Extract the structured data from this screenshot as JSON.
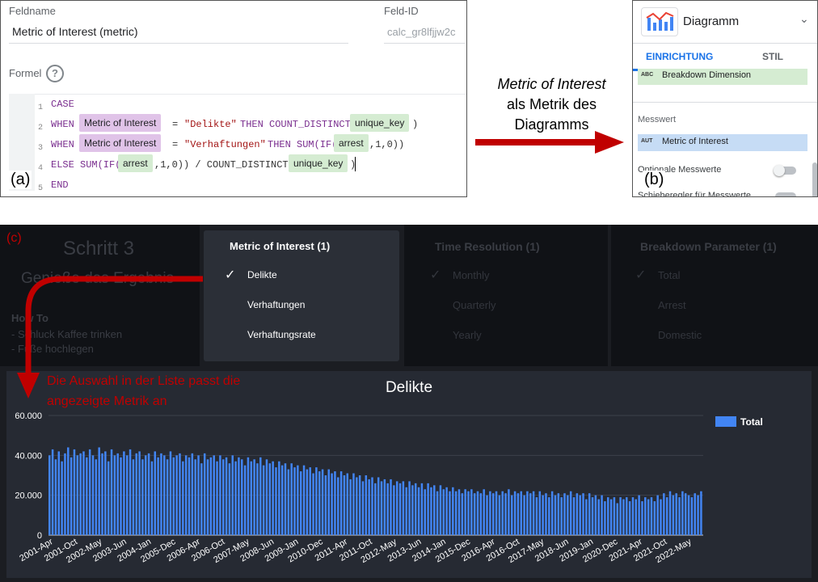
{
  "panel_a": {
    "tag": "(a)",
    "field_name_label": "Feldname",
    "field_name_value": "Metric of Interest (metric)",
    "field_id_label": "Feld-ID",
    "field_id_value": "calc_gr8lfjjw2c",
    "formula_label": "Formel",
    "help_icon": "?",
    "lines": [
      {
        "n": "1"
      },
      {
        "n": "2"
      },
      {
        "n": "3"
      },
      {
        "n": "4"
      },
      {
        "n": "5"
      }
    ],
    "code": {
      "case": "CASE",
      "when": "WHEN",
      "moi": "Metric of Interest",
      "eq_delikte": "= \"Delikte\" THEN COUNT_DISTINCT(",
      "eq_delikte_eq": "=",
      "str_delikte": "\"Delikte\"",
      "then_count": "THEN COUNT_DISTINCT(",
      "unique_key": "unique_key",
      "close": ")",
      "str_verh": "\"Verhaftungen\"",
      "then_sum": "THEN SUM(IF(",
      "arrest": "arrest",
      "one_zero_close": ",1,0))",
      "else_sum": "ELSE SUM(IF(",
      "div_count": ",1,0)) / COUNT_DISTINCT(",
      "end": "END"
    }
  },
  "arrow_text": {
    "line1": "Metric of Interest",
    "line2": "als Metrik des",
    "line3": "Diagramms"
  },
  "panel_b": {
    "tag": "(b)",
    "chart_type": "Diagramm",
    "tab_setup": "EINRICHTUNG",
    "tab_style": "STIL",
    "breakdown_badge": "ABC",
    "breakdown_label": "Breakdown Dimension",
    "metric_section": "Messwert",
    "metric_badge": "AUT",
    "metric_label": "Metric of Interest",
    "optional_metrics": "Optionale Messwerte",
    "metric_slider": "Schieberegler für Messwerte"
  },
  "panel_c": {
    "tag": "(c)",
    "step_title": "Schritt 3",
    "step_sub": "Genieße das Ergebnis",
    "howto_title": "How To",
    "howto_1": "- Schluck Kaffee trinken",
    "howto_2": "- Füße hochlegen",
    "dropdown_title": "Metric of Interest (1)",
    "dropdown_items": [
      "Delikte",
      "Verhaftungen",
      "Verhaftungsrate"
    ],
    "time_title": "Time Resolution (1)",
    "time_items": [
      "Monthly",
      "Quarterly",
      "Yearly"
    ],
    "breakdown_title": "Breakdown Parameter (1)",
    "breakdown_items": [
      "Total",
      "Arrest",
      "Domestic"
    ],
    "annotation_1": "Die Auswahl in der Liste passt die",
    "annotation_2": "angezeigte Metrik an"
  },
  "chart_data": {
    "type": "bar",
    "title": "Delikte",
    "xlabel": "",
    "ylabel": "",
    "ylim": [
      0,
      60000
    ],
    "y_ticks": [
      "0",
      "20.000",
      "40.000",
      "60.000"
    ],
    "x_tick_labels": [
      "2001-Apr",
      "2001-Oct",
      "2002-May",
      "2003-Jun",
      "2004-Jan",
      "2005-Dec",
      "2006-Apr",
      "2006-Oct",
      "2007-May",
      "2008-Jun",
      "2009-Jan",
      "2010-Dec",
      "2011-Apr",
      "2011-Oct",
      "2012-May",
      "2013-Jun",
      "2014-Jan",
      "2015-Dec",
      "2016-Apr",
      "2016-Oct",
      "2017-May",
      "2018-Jun",
      "2019-Jan",
      "2020-Dec",
      "2021-Apr",
      "2021-Oct",
      "2022-May"
    ],
    "series": [
      {
        "name": "Total",
        "color": "#4285f4",
        "values": [
          40000,
          43000,
          38000,
          42000,
          37000,
          41000,
          44000,
          39000,
          43000,
          40000,
          41000,
          42000,
          39000,
          43000,
          40000,
          38000,
          44000,
          41000,
          42000,
          37000,
          43000,
          40000,
          41000,
          39000,
          42000,
          40000,
          43000,
          38000,
          41000,
          42000,
          38000,
          40000,
          41000,
          37000,
          42000,
          39000,
          41000,
          40000,
          38000,
          42000,
          39000,
          40000,
          41000,
          37000,
          40000,
          39000,
          41000,
          38000,
          40000,
          36000,
          41000,
          38000,
          39000,
          40000,
          37000,
          40000,
          38000,
          39000,
          36000,
          40000,
          37000,
          39000,
          38000,
          35000,
          39000,
          37000,
          38000,
          36000,
          39000,
          35000,
          38000,
          36000,
          37000,
          34000,
          37000,
          35000,
          36000,
          33000,
          36000,
          34000,
          35000,
          32000,
          35000,
          33000,
          34000,
          31000,
          34000,
          32000,
          33000,
          30000,
          33000,
          31000,
          32000,
          29000,
          32000,
          30000,
          31000,
          28000,
          31000,
          29000,
          30000,
          27000,
          30000,
          28000,
          29000,
          26000,
          29000,
          27000,
          28000,
          26000,
          28000,
          25000,
          27000,
          26000,
          27000,
          24000,
          27000,
          25000,
          26000,
          24000,
          26000,
          23000,
          26000,
          24000,
          25000,
          22000,
          25000,
          23000,
          24000,
          22000,
          24000,
          22000,
          23000,
          21000,
          23000,
          22000,
          23000,
          21000,
          22000,
          21000,
          23000,
          20000,
          22000,
          21000,
          22000,
          20000,
          22000,
          21000,
          23000,
          20000,
          22000,
          21000,
          22000,
          20000,
          22000,
          21000,
          22000,
          19000,
          22000,
          20000,
          21000,
          19000,
          22000,
          20000,
          21000,
          19000,
          21000,
          20000,
          22000,
          19000,
          21000,
          20000,
          21000,
          18000,
          21000,
          19000,
          20000,
          18000,
          20000,
          17000,
          19000,
          18000,
          19000,
          16000,
          19000,
          18000,
          19000,
          17000,
          19000,
          18000,
          20000,
          17000,
          19000,
          18000,
          19000,
          17000,
          20000,
          18000,
          21000,
          19000,
          22000,
          20000,
          21000,
          19000,
          22000,
          21000,
          20000,
          19000,
          21000,
          20000,
          22000
        ]
      }
    ],
    "legend": "top-right"
  }
}
